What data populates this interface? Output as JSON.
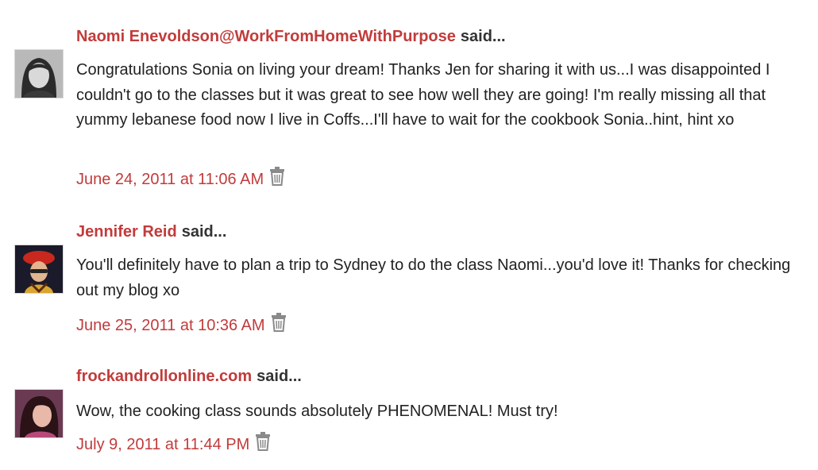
{
  "comments": [
    {
      "author": "Naomi Enevoldson@WorkFromHomeWithPurpose",
      "said": "said...",
      "avatar_icon": "avatar-photo-woman-dark-hair",
      "body": "Congratulations Sonia on living your dream! Thanks Jen for sharing it with us...I was disappointed I couldn't go to the classes but it was great to see how well they are going! I'm really missing all that yummy lebanese food now I live in Coffs...I'll have to wait for the cookbook Sonia..hint, hint xo",
      "timestamp": "June 24, 2011 at 11:06 AM",
      "delete_icon": "trash-icon"
    },
    {
      "author": "Jennifer Reid",
      "said": "said...",
      "avatar_icon": "avatar-photo-woman-red-beret",
      "body": "You'll definitely have to plan a trip to Sydney to do the class Naomi...you'd love it! Thanks for checking out my blog xo",
      "timestamp": "June 25, 2011 at 10:36 AM",
      "delete_icon": "trash-icon"
    },
    {
      "author": "frockandrollonline.com",
      "said": "said...",
      "avatar_icon": "avatar-photo-woman-dark-hair-pink",
      "body": "Wow, the cooking class sounds absolutely PHENOMENAL! Must try!",
      "timestamp": "July 9, 2011 at 11:44 PM",
      "delete_icon": "trash-icon"
    }
  ],
  "colors": {
    "link": "#c23b3b",
    "text": "#222222",
    "said": "#333333",
    "trash": "#8a8a8a"
  }
}
